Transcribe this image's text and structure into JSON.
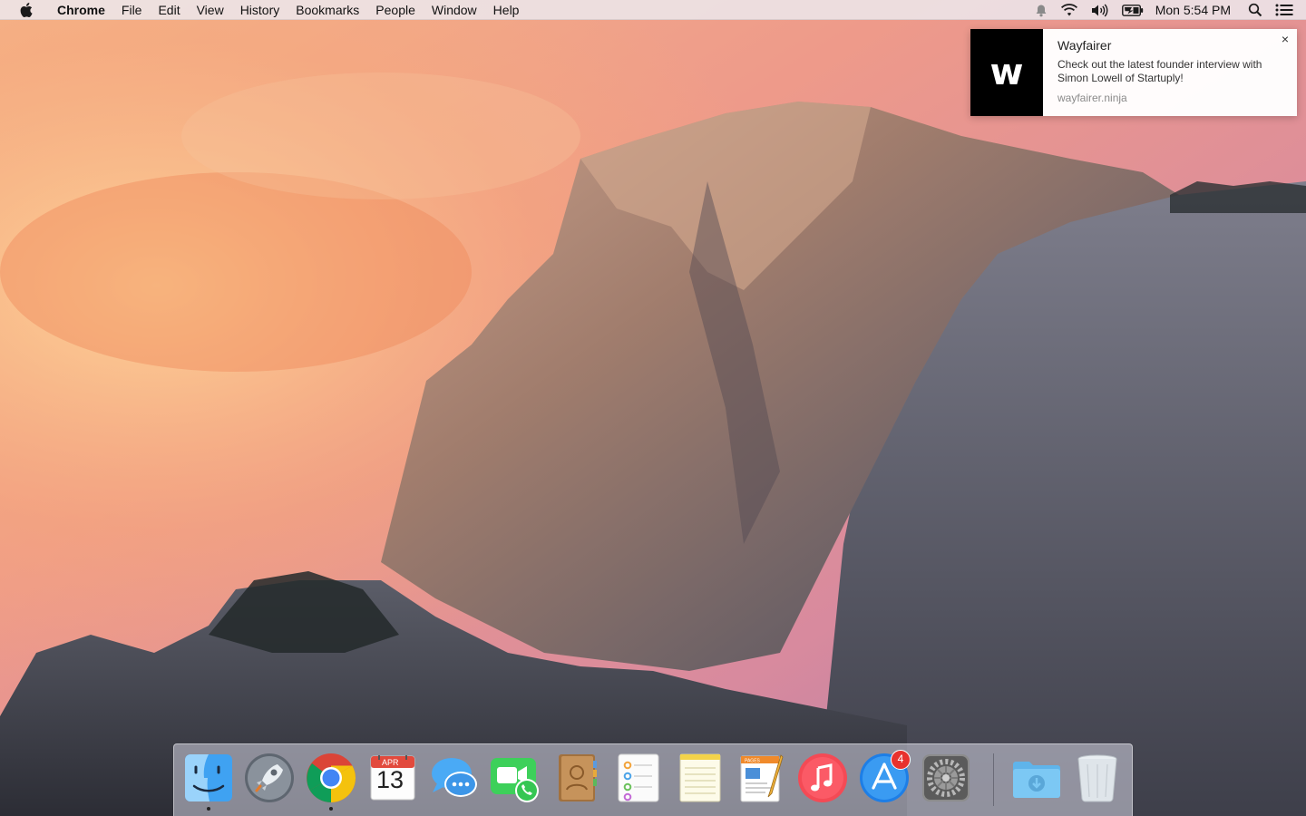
{
  "menubar": {
    "app_name": "Chrome",
    "items": [
      "File",
      "Edit",
      "View",
      "History",
      "Bookmarks",
      "People",
      "Window",
      "Help"
    ],
    "clock": "Mon 5:54 PM",
    "status_icons": [
      "notifications-icon",
      "wifi-icon",
      "volume-icon",
      "battery-icon",
      "spotlight-icon",
      "notification-center-icon"
    ]
  },
  "notification": {
    "logo_letter": "w",
    "title": "Wayfairer",
    "body": "Check out the latest founder interview with Simon Lowell of Startuply!",
    "origin": "wayfairer.ninja",
    "close_label": "×"
  },
  "dock": {
    "apps": [
      {
        "name": "Finder",
        "icon": "finder-icon",
        "running": true
      },
      {
        "name": "Launchpad",
        "icon": "launchpad-icon",
        "running": false
      },
      {
        "name": "Google Chrome",
        "icon": "chrome-icon",
        "running": true
      },
      {
        "name": "Calendar",
        "icon": "calendar-icon",
        "running": false,
        "month": "APR",
        "day": "13"
      },
      {
        "name": "Messages",
        "icon": "messages-icon",
        "running": false
      },
      {
        "name": "FaceTime",
        "icon": "facetime-icon",
        "running": false
      },
      {
        "name": "Contacts",
        "icon": "contacts-icon",
        "running": false
      },
      {
        "name": "Reminders",
        "icon": "reminders-icon",
        "running": false
      },
      {
        "name": "Notes",
        "icon": "notes-icon",
        "running": false
      },
      {
        "name": "Pages",
        "icon": "pages-icon",
        "running": false,
        "label": "PAGES"
      },
      {
        "name": "iTunes",
        "icon": "itunes-icon",
        "running": false
      },
      {
        "name": "App Store",
        "icon": "app-store-icon",
        "running": false,
        "badge": "4"
      },
      {
        "name": "System Preferences",
        "icon": "system-preferences-icon",
        "running": false
      },
      {
        "name": "Downloads",
        "icon": "downloads-folder-icon",
        "running": false
      },
      {
        "name": "Trash",
        "icon": "trash-icon",
        "running": false
      }
    ]
  },
  "colors": {
    "badge": "#e8322d",
    "notification_logo_bg": "#000000"
  }
}
